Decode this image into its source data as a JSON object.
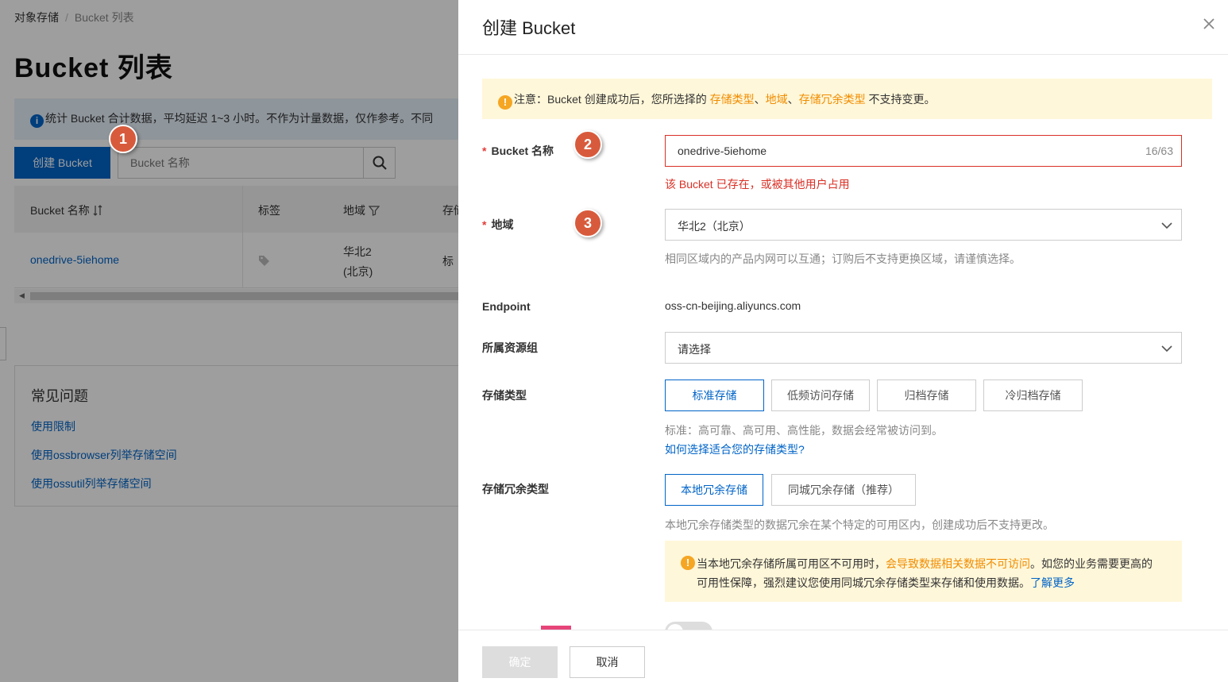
{
  "background": {
    "breadcrumb": {
      "root": "对象存储",
      "separator": "/",
      "current": "Bucket 列表"
    },
    "page_title": "Bucket 列表",
    "notice": "统计 Bucket 合计数据，平均延迟 1~3 小时。不作为计量数据，仅作参考。不同",
    "create_button": "创建 Bucket",
    "search_placeholder": "Bucket 名称",
    "table": {
      "headers": {
        "name": "Bucket 名称",
        "tags": "标签",
        "region": "地域",
        "storage": "存储"
      },
      "row": {
        "name": "onedrive-5iehome",
        "region_line1": "华北2",
        "region_line2": "(北京)",
        "storage": "标"
      }
    },
    "faq": {
      "title": "常见问题",
      "links": [
        "使用限制",
        "使用ossbrowser列举存储空间",
        "使用ossutil列举存储空间"
      ]
    }
  },
  "steps": [
    "1",
    "2",
    "3"
  ],
  "drawer": {
    "title": "创建 Bucket",
    "warning": {
      "prefix": "注意：Bucket 创建成功后，您所选择的 ",
      "hl1": "存储类型",
      "sep1": "、",
      "hl2": "地域",
      "sep2": "、",
      "hl3": "存储冗余类型",
      "suffix": " 不支持变更。"
    },
    "bucket_name": {
      "label": "Bucket 名称",
      "value": "onedrive-5iehome",
      "count": "16/63",
      "error": "该 Bucket 已存在，或被其他用户占用"
    },
    "region": {
      "label": "地域",
      "value": "华北2（北京）",
      "help": "相同区域内的产品内网可以互通；订购后不支持更换区域，请谨慎选择。"
    },
    "endpoint": {
      "label": "Endpoint",
      "value": "oss-cn-beijing.aliyuncs.com"
    },
    "resource_group": {
      "label": "所属资源组",
      "placeholder": "请选择"
    },
    "storage_class": {
      "label": "存储类型",
      "options": [
        "标准存储",
        "低频访问存储",
        "归档存储",
        "冷归档存储"
      ],
      "help": "标准：高可靠、高可用、高性能，数据会经常被访问到。",
      "link": "如何选择适合您的存储类型?"
    },
    "redundancy": {
      "label": "存储冗余类型",
      "options": [
        "本地冗余存储",
        "同城冗余存储（推荐）"
      ],
      "help": "本地冗余存储类型的数据冗余在某个特定的可用区内，创建成功后不支持更改。",
      "warning": {
        "prefix": "当本地冗余存储所属可用区不可用时，",
        "highlight": "会导致数据相关数据不可访问",
        "middle": "。如您的业务需要更高的",
        "line2": "可用性保障，强烈建议您使用同城冗余存储类型来存储和使用数据。",
        "link": "了解更多"
      }
    },
    "footer": {
      "ok": "确定",
      "cancel": "取消"
    }
  },
  "colors": {
    "primary": "#0064c8",
    "error": "#d93026",
    "warning": "#f08c00",
    "badge": "#d85a3c"
  }
}
